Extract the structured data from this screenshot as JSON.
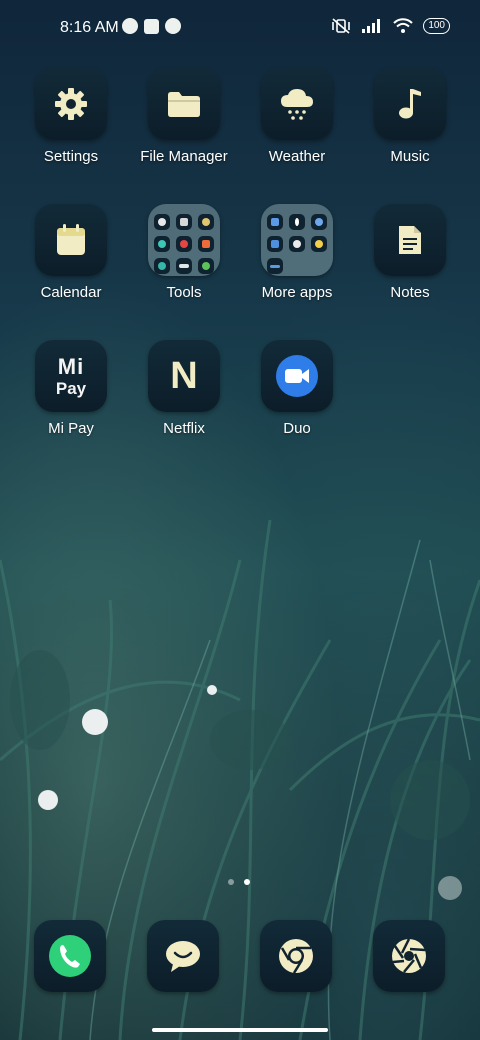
{
  "status": {
    "time": "8:16 AM",
    "battery": "100"
  },
  "apps": [
    {
      "label": "Settings",
      "icon": "gear-icon"
    },
    {
      "label": "File Manager",
      "icon": "folder-icon"
    },
    {
      "label": "Weather",
      "icon": "cloud-snow-icon"
    },
    {
      "label": "Music",
      "icon": "music-note-icon"
    },
    {
      "label": "Calendar",
      "icon": "calendar-icon"
    },
    {
      "label": "Tools",
      "icon": "folder-tools-icon"
    },
    {
      "label": "More apps",
      "icon": "folder-more-apps-icon"
    },
    {
      "label": "Notes",
      "icon": "notes-icon"
    },
    {
      "label": "Mi Pay",
      "icon": "mi-pay-icon",
      "text_top": "Mi",
      "text_bottom": "Pay"
    },
    {
      "label": "Netflix",
      "icon": "netflix-icon",
      "glyph": "N"
    },
    {
      "label": "Duo",
      "icon": "duo-camera-icon"
    }
  ],
  "dock": [
    {
      "icon": "phone-icon"
    },
    {
      "icon": "messages-icon"
    },
    {
      "icon": "chrome-icon"
    },
    {
      "icon": "camera-aperture-icon"
    }
  ],
  "pages": {
    "count": 2,
    "active": 1
  }
}
